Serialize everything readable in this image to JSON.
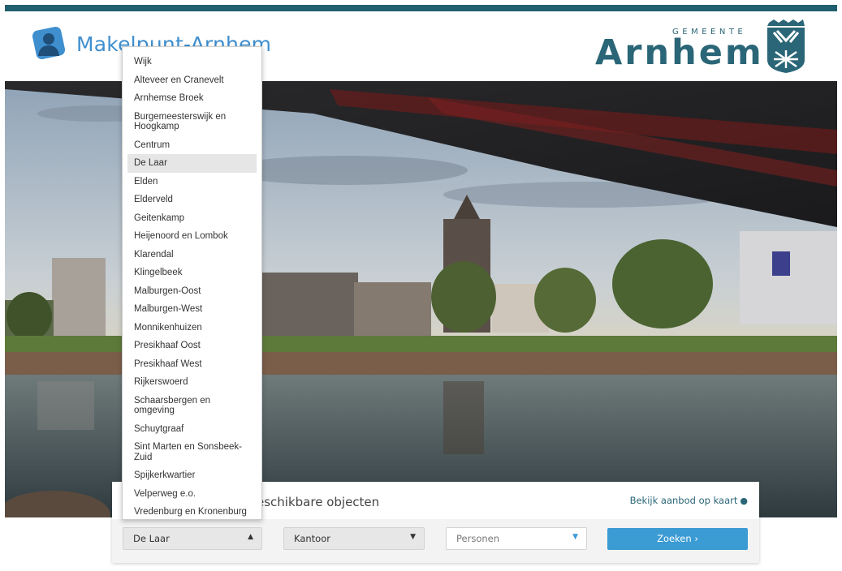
{
  "header": {
    "site_title": "Makelpunt-Arnhem",
    "municipality_small": "GEMEENTE",
    "municipality_name": "Arnhem"
  },
  "search": {
    "available_text": "eschikbare objecten",
    "map_link": "Bekijk aanbod op kaart",
    "wijk_selected": "De Laar",
    "type_selected": "Kantoor",
    "persons_placeholder": "Personen",
    "submit_label": "Zoeken ›"
  },
  "dropdown": {
    "items": [
      "Wijk",
      "Alteveer en Cranevelt",
      "Arnhemse Broek",
      "Burgemeesterswijk en Hoogkamp",
      "Centrum",
      "De Laar",
      "Elden",
      "Elderveld",
      "Geitenkamp",
      "Heijenoord en Lombok",
      "Klarendal",
      "Klingelbeek",
      "Malburgen-Oost",
      "Malburgen-West",
      "Monnikenhuizen",
      "Presikhaaf Oost",
      "Presikhaaf West",
      "Rijkerswoerd",
      "Schaarsbergen en omgeving",
      "Schuytgraaf",
      "Sint Marten en Sonsbeek-Zuid",
      "Spijkerkwartier",
      "Velperweg e.o.",
      "Vredenburg en Kronenburg"
    ],
    "highlighted": "De Laar"
  },
  "colors": {
    "brand_teal": "#1f5f6e",
    "logo_blue": "#3f8fcf",
    "button_blue": "#3b9bd3"
  },
  "icons": {
    "logo": "person-silhouette-icon",
    "map_pin": "map-marker-icon",
    "caret": "caret-down-icon"
  }
}
